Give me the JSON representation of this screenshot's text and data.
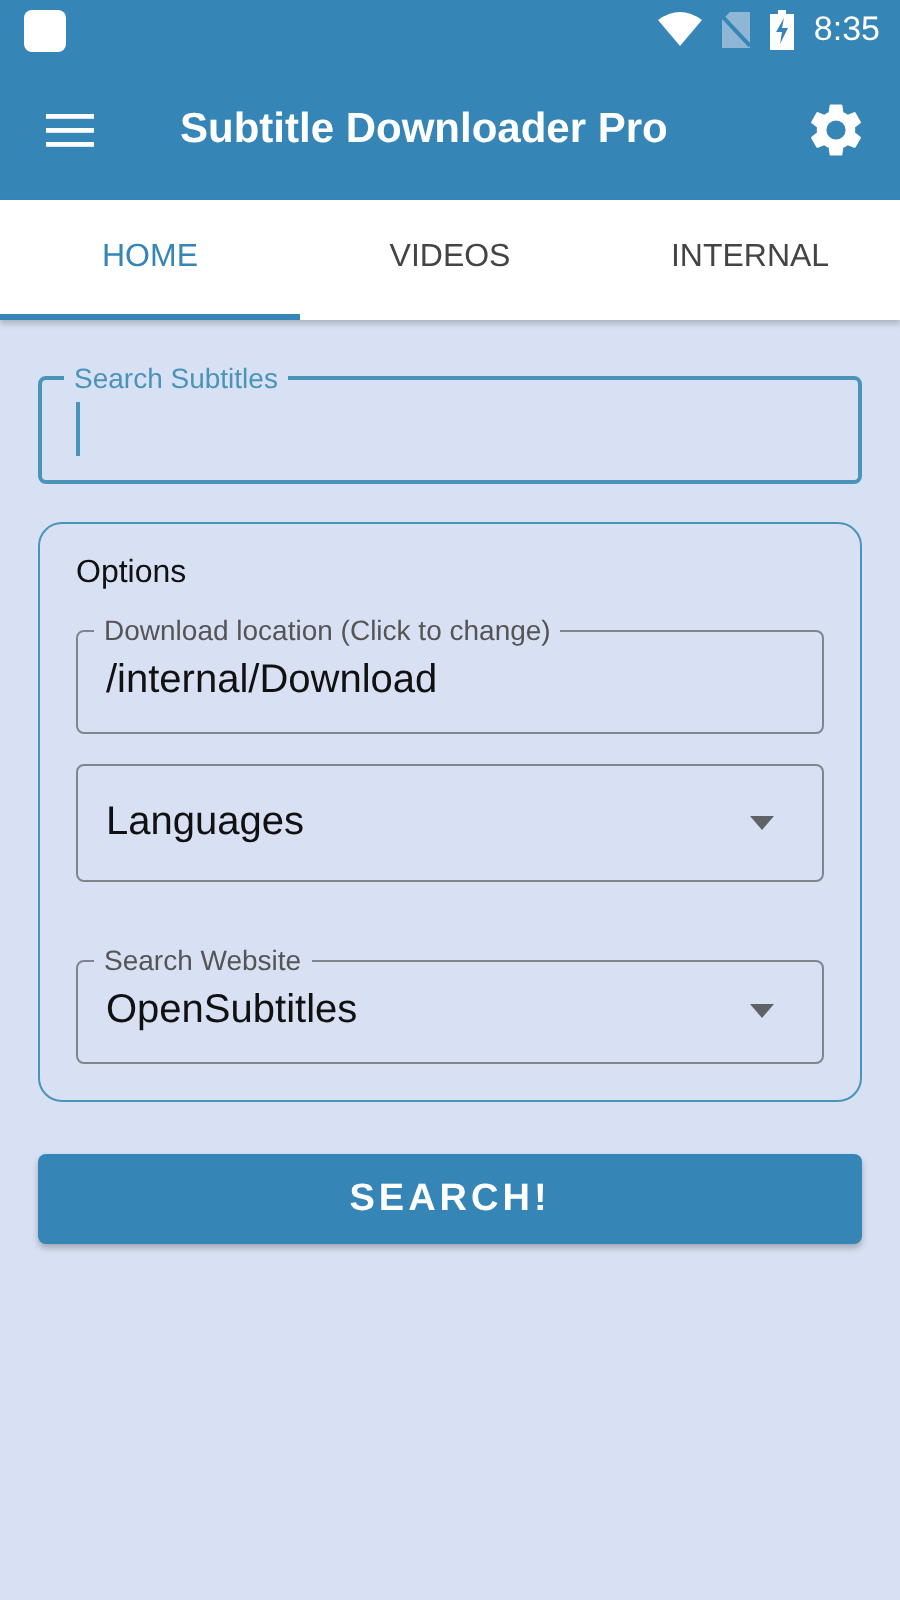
{
  "status_bar": {
    "time": "8:35"
  },
  "app_bar": {
    "title": "Subtitle Downloader Pro"
  },
  "tabs": [
    {
      "label": "HOME",
      "selected": true
    },
    {
      "label": "VIDEOS",
      "selected": false
    },
    {
      "label": "INTERNAL",
      "selected": false
    }
  ],
  "search": {
    "label": "Search Subtitles",
    "focused": true
  },
  "options": {
    "title": "Options",
    "fields": [
      {
        "kind": "text",
        "label": "Download location (Click to change)",
        "value": "/internal/Download"
      },
      {
        "kind": "select",
        "value": "Languages"
      },
      {
        "kind": "select",
        "label": "Search Website",
        "value": "OpenSubtitles"
      }
    ]
  },
  "button": "SEARCH!"
}
